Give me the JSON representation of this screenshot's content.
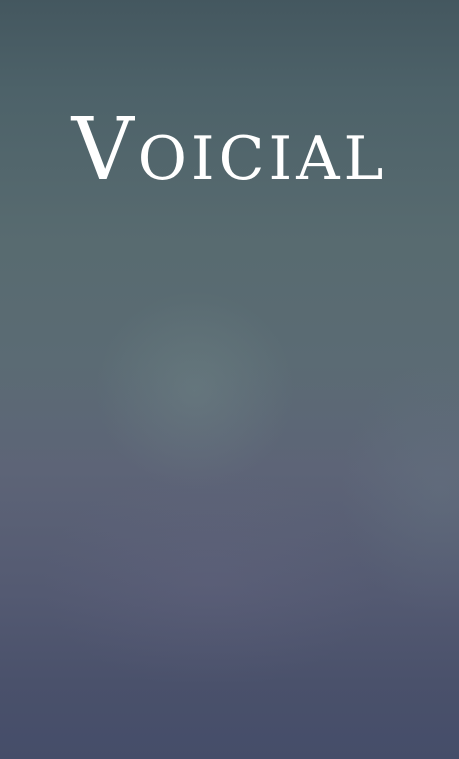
{
  "splash": {
    "app_title": "Voicial"
  },
  "colors": {
    "background_top": "#44575f",
    "background_middle": "#586b70",
    "background_bottom": "#454d69",
    "title_text": "#ffffff"
  }
}
